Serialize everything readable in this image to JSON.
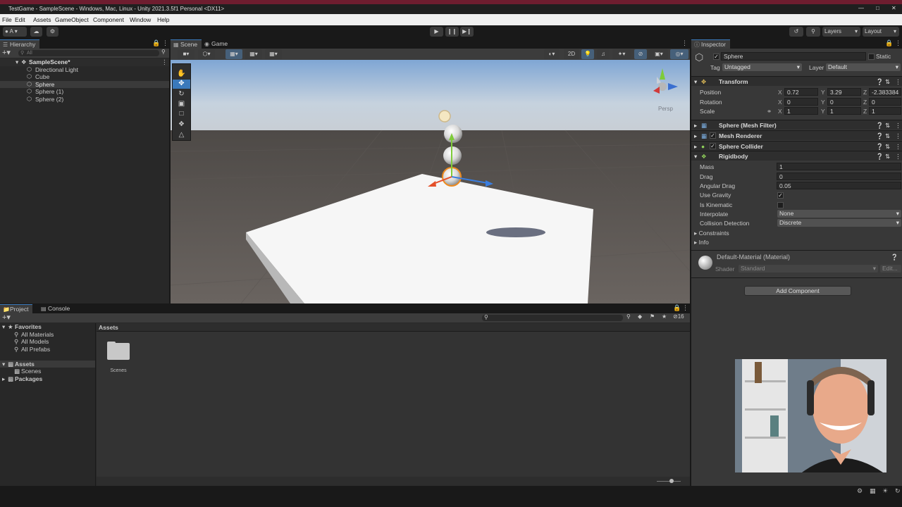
{
  "window": {
    "title": "TestGame - SampleScene - Windows, Mac, Linux - Unity 2021.3.5f1 Personal <DX11>"
  },
  "menu": [
    "File",
    "Edit",
    "Assets",
    "GameObject",
    "Component",
    "Window",
    "Help"
  ],
  "toolbar": {
    "layers_label": "Layers",
    "layout_label": "Layout",
    "account_label": "A"
  },
  "hierarchy": {
    "tab": "Hierarchy",
    "search_placeholder": "All",
    "scene": "SampleScene*",
    "items": [
      "Directional Light",
      "Cube",
      "Sphere",
      "Sphere (1)",
      "Sphere (2)"
    ],
    "selected_index": 2
  },
  "scene_tabs": {
    "scene": "Scene",
    "game": "Game"
  },
  "scene_toolbar": {
    "mode_2d": "2D",
    "persp_label": "Persp"
  },
  "inspector": {
    "tab": "Inspector",
    "object_name": "Sphere",
    "static_label": "Static",
    "tag_label": "Tag",
    "tag_value": "Untagged",
    "layer_label": "Layer",
    "layer_value": "Default",
    "transform": {
      "title": "Transform",
      "position": {
        "label": "Position",
        "x": "0.72",
        "y": "3.29",
        "z": "-2.383384"
      },
      "rotation": {
        "label": "Rotation",
        "x": "0",
        "y": "0",
        "z": "0"
      },
      "scale": {
        "label": "Scale",
        "x": "1",
        "y": "1",
        "z": "1"
      }
    },
    "components": [
      "Sphere (Mesh Filter)",
      "Mesh Renderer",
      "Sphere Collider",
      "Rigidbody"
    ],
    "rigidbody": {
      "mass_label": "Mass",
      "mass": "1",
      "drag_label": "Drag",
      "drag": "0",
      "angular_drag_label": "Angular Drag",
      "angular_drag": "0.05",
      "use_gravity_label": "Use Gravity",
      "use_gravity": true,
      "is_kinematic_label": "Is Kinematic",
      "is_kinematic": false,
      "interpolate_label": "Interpolate",
      "interpolate": "None",
      "collision_label": "Collision Detection",
      "collision": "Discrete",
      "constraints_label": "Constraints",
      "info_label": "Info"
    },
    "material": {
      "name": "Default-Material (Material)",
      "shader_label": "Shader",
      "shader": "Standard",
      "edit_label": "Edit..."
    },
    "add_component_label": "Add Component"
  },
  "project": {
    "tab": "Project",
    "console_tab": "Console",
    "favorites_label": "Favorites",
    "favorites": [
      "All Materials",
      "All Models",
      "All Prefabs"
    ],
    "assets_label": "Assets",
    "asset_folders": [
      "Scenes"
    ],
    "packages_label": "Packages",
    "breadcrumb": "Assets",
    "grid_items": [
      "Scenes"
    ],
    "hidden_count": "16"
  },
  "colors": {
    "accent": "#3a79bb",
    "title_strip": "#6e1d2f",
    "panel": "#282828"
  }
}
